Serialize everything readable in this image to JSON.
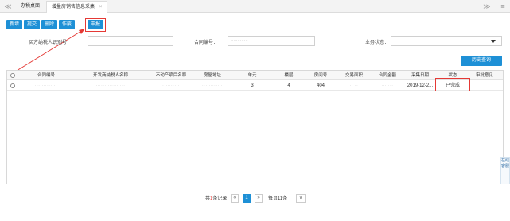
{
  "tabs": [
    {
      "label": "办税桌面",
      "active": false
    },
    {
      "label": "增量房销售信息采集",
      "active": true,
      "close": "×"
    }
  ],
  "nav": {
    "prev": "≪",
    "next": "≫",
    "more": "≡"
  },
  "toolbar": {
    "buttons": [
      "新增",
      "提交",
      "删除",
      "作废",
      "申报"
    ]
  },
  "search": {
    "buyer_label": "买方纳税人识别号：",
    "buyer_value": "",
    "contract_label": "合同编号：",
    "contract_value": "·············",
    "status_label": "业务状态：",
    "status_value": "",
    "history_button": "历史查询"
  },
  "grid": {
    "columns": [
      "合同编号",
      "开发商纳税人名称",
      "不动产项目名称",
      "房屋地址",
      "单元",
      "楼层",
      "房间号",
      "交易面积",
      "合同金额",
      "采集日期",
      "状态",
      "审批意见"
    ],
    "rows": [
      [
        "·············",
        "·················",
        "··········",
        "············",
        "3",
        "4",
        "404",
        "·· ··",
        "··· ···",
        "2019-12-2...",
        "已完成",
        ""
      ]
    ]
  },
  "pager": {
    "total_prefix": "共",
    "total_count": "1",
    "total_suffix": "条记录",
    "first": "«",
    "current": "1",
    "last": "»",
    "page_size": "每页11条",
    "dropdown": "∨"
  },
  "service": {
    "label": "在线客服"
  },
  "colors": {
    "accent": "#1e90d6",
    "highlight": "#e53935"
  }
}
